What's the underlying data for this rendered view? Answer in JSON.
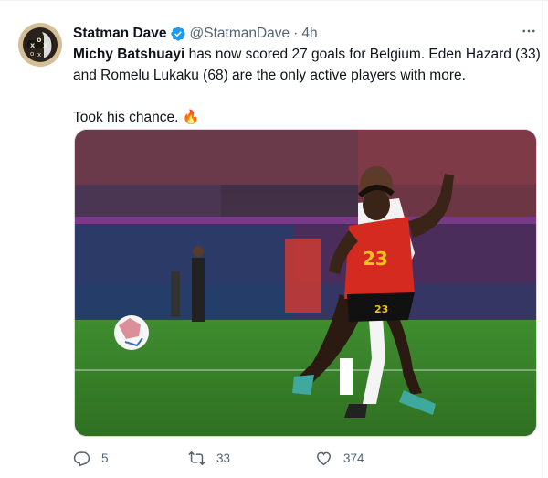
{
  "tweet": {
    "author_name": "Statman Dave",
    "author_handle": "@StatmanDave",
    "separator": "·",
    "timestamp": "4h",
    "verified": true,
    "text": {
      "bold_name": "Michy Batshuayi",
      "line1_rest": " has now scored 27 goals for Belgium. Eden Hazard (33)",
      "line2": "and Romelu Lukaku (68) are the only active players with more.",
      "line3": "Took his chance.",
      "emoji": "🔥"
    },
    "media": {
      "shirt_number": "23"
    },
    "actions": {
      "reply_count": "5",
      "retweet_count": "33",
      "like_count": "374"
    }
  },
  "colors": {
    "verified_blue": "#1d9bf0",
    "secondary_text": "#536471",
    "primary_text": "#0f1419",
    "belgium_red": "#d42a1f"
  },
  "icons": [
    "verified-badge-icon",
    "more-icon",
    "reply-icon",
    "retweet-icon",
    "like-icon",
    "fire-emoji"
  ]
}
